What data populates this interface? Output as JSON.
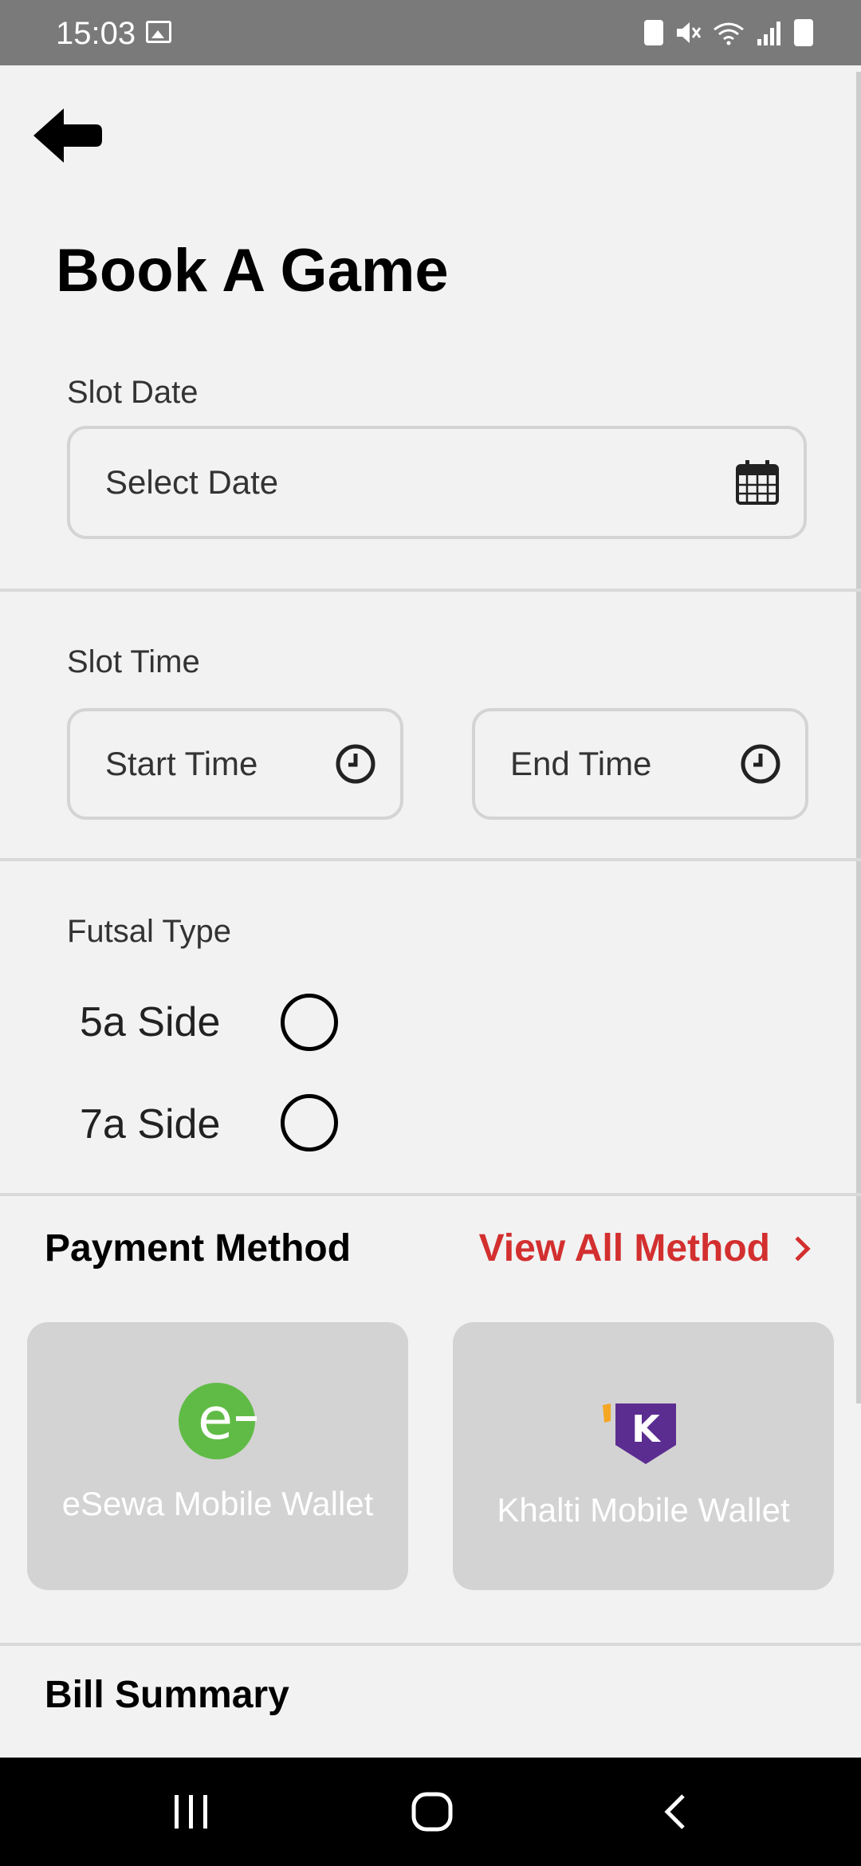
{
  "status_bar": {
    "time": "15:03"
  },
  "page": {
    "title": "Book A Game"
  },
  "slot_date": {
    "label": "Slot Date",
    "placeholder": "Select Date"
  },
  "slot_time": {
    "label": "Slot Time",
    "start_placeholder": "Start Time",
    "end_placeholder": "End Time"
  },
  "futsal_type": {
    "label": "Futsal Type",
    "options": [
      {
        "label": "5a Side",
        "selected": false
      },
      {
        "label": "7a Side",
        "selected": false
      }
    ]
  },
  "payment": {
    "title": "Payment Method",
    "view_all": "View All Method",
    "wallets": [
      {
        "name": "eSewa Mobile Wallet",
        "icon": "esewa-logo",
        "brand_color": "#60bb46"
      },
      {
        "name": "Khalti Mobile Wallet",
        "icon": "khalti-logo",
        "brand_color": "#5c2d91"
      }
    ]
  },
  "bill": {
    "title": "Bill Summary"
  },
  "colors": {
    "accent": "#d32f2f",
    "background": "#f2f2f2",
    "card": "#d3d3d3"
  }
}
